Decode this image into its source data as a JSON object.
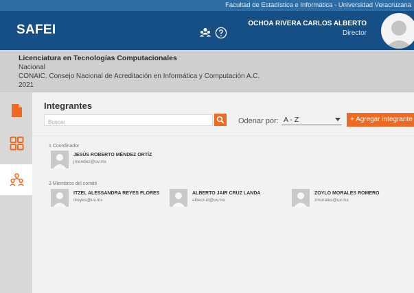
{
  "topbar": {
    "institution": "Facultad de Estadística e Informática - Universidad Veracruzana"
  },
  "header": {
    "app_name": "SAFEI",
    "user_name": "OCHOA RIVERA CARLOS ALBERTO",
    "user_role": "Director",
    "icons": [
      "users-icon",
      "help-icon",
      "avatar"
    ]
  },
  "program": {
    "name": "Licenciatura en Tecnologías Computacionales",
    "scope": "Nacional",
    "body": "CONAIC. Consejo Nacional de Acreditación en Informática y Computación A.C.",
    "year": "2021"
  },
  "sidebar": {
    "items": [
      "document-icon",
      "grid-icon",
      "team-icon"
    ],
    "active": "team-icon"
  },
  "main": {
    "title": "Integrantes",
    "search_placeholder": "Buscar",
    "sort_label": "Odenar por:",
    "sort_value": "A - Z",
    "add_button": "+ Agregar integrante"
  },
  "groups": [
    {
      "label": "1 Coordinador",
      "members": [
        {
          "name": "JESÚS ROBERTO MÉNDEZ ORTÍZ",
          "email": "jmendez@uv.mx"
        }
      ]
    },
    {
      "label": "3 Miembros del comité",
      "members": [
        {
          "name": "ITZEL ALESSANDRA REYES FLORES",
          "email": "itreyes@uv.mx"
        },
        {
          "name": "ALBERTO JAIR CRUZ LANDA",
          "email": "albecruz@uv.mx"
        },
        {
          "name": "ZOYLO MORALES ROMERO",
          "email": "zmorales@uv.mx"
        }
      ]
    }
  ],
  "colors": {
    "primary": "#164f86",
    "accent": "#ee6a22",
    "topstrip": "#2d6da3"
  }
}
